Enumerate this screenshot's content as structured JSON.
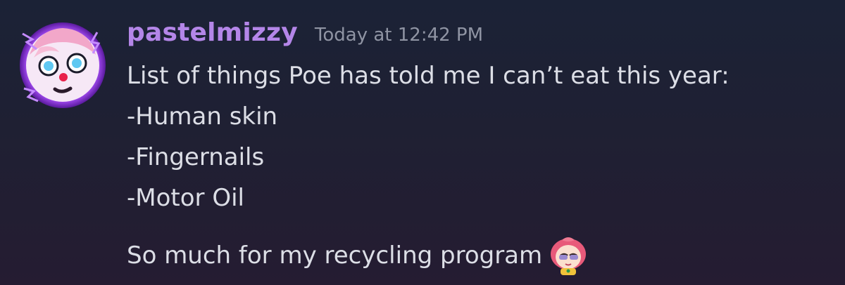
{
  "message": {
    "author": "pastelmizzy",
    "timestamp": "Today at 12:42 PM",
    "lines": [
      "List of things Poe has told me I can’t eat this year:",
      "-Human skin",
      "-Fingernails",
      "-Motor Oil"
    ],
    "closing_line": "So much for my recycling program"
  },
  "icons": {
    "avatar": "clown-avatar-icon",
    "custom_emoji": "sleepy-pink-girl-emoji-icon"
  },
  "colors": {
    "username": "#b486e8",
    "timestamp": "#8f94a3",
    "text": "#dcdee6",
    "background_top": "#1b2236",
    "background_bottom": "#251c32"
  }
}
